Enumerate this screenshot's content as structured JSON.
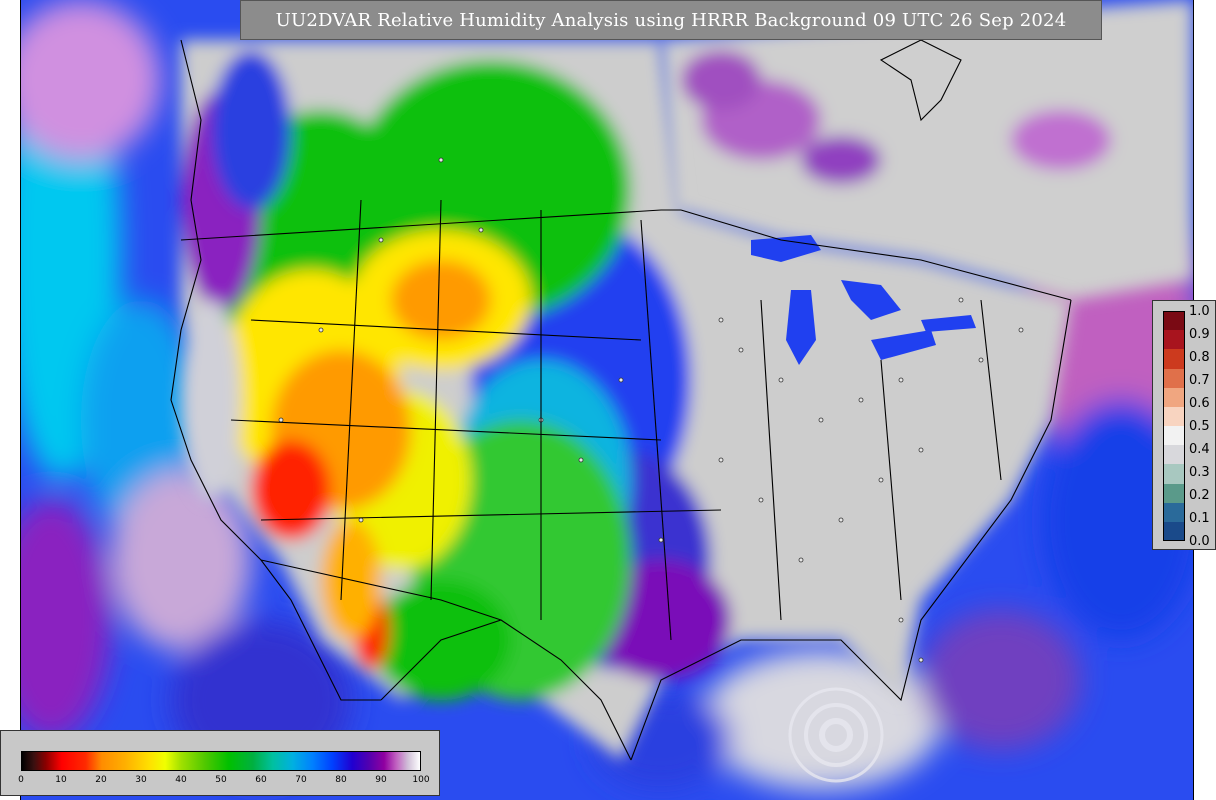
{
  "title": "UU2DVAR Relative Humidity Analysis using HRRR Background 09 UTC 26 Sep 2024",
  "colorbar_rh": {
    "ticks": [
      "0",
      "10",
      "20",
      "30",
      "40",
      "50",
      "60",
      "70",
      "80",
      "90",
      "100"
    ]
  },
  "colorbar_obs": {
    "ticks": [
      "1.0",
      "0.9",
      "0.8",
      "0.7",
      "0.6",
      "0.5",
      "0.4",
      "0.3",
      "0.2",
      "0.1",
      "0.0"
    ],
    "colors": [
      "#7a0a14",
      "#a8141e",
      "#cc3a1e",
      "#e0704a",
      "#f0a680",
      "#f8d4c0",
      "#f2f2f2",
      "#d8d8dc",
      "#a8c8c0",
      "#5a9a8a",
      "#2a6a9a",
      "#1a4a8a"
    ]
  },
  "map": {
    "background_color": "#3366ff",
    "land_colors": {
      "dry_red": "#ff2000",
      "orange": "#ff9a00",
      "yellow": "#ffe600",
      "green": "#10c010",
      "cyan": "#10b4e0",
      "blue": "#2040f0",
      "purple": "#7a10b8",
      "gray_humid": "#cdcdcd"
    }
  }
}
